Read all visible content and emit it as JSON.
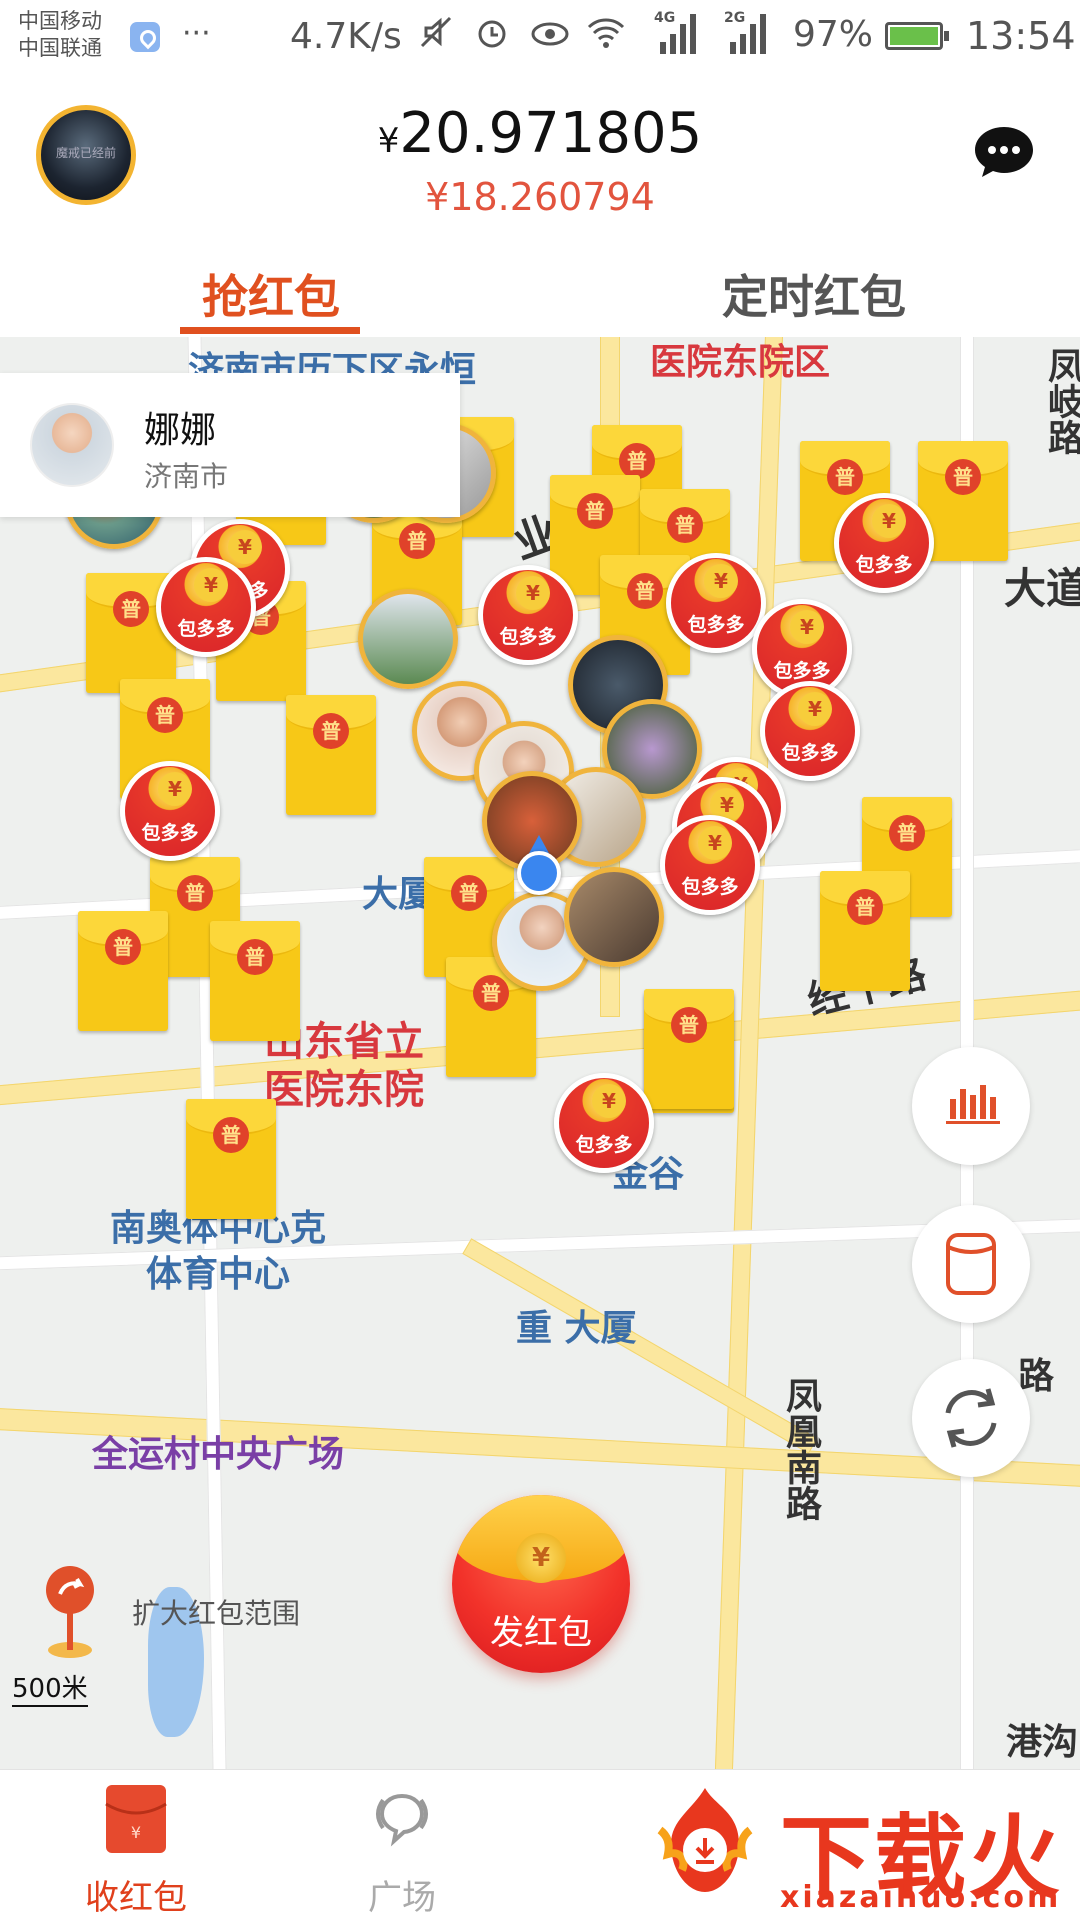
{
  "status_bar": {
    "carrier_1": "中国移动",
    "carrier_2": "中国联通",
    "more": "···",
    "net_speed": "4.7K/s",
    "net_4g": "4G",
    "net_2g": "2G",
    "battery": "97%",
    "time": "13:54"
  },
  "header": {
    "balance_currency": "¥",
    "balance_main": "20.971805",
    "balance_sub": "¥18.260794",
    "avatar_text": "魔戒已经前",
    "chat_icon": "chat-bubble-icon"
  },
  "tabs": [
    {
      "label": "抢红包",
      "active": true
    },
    {
      "label": "定时红包",
      "active": false
    }
  ],
  "user_card": {
    "name": "娜娜",
    "city": "济南市"
  },
  "map": {
    "labels": [
      {
        "text": "济南市历下区永恒",
        "style": "blue"
      },
      {
        "text": "医院东院区",
        "style": "red"
      },
      {
        "text": "业南路",
        "style": "dark"
      },
      {
        "text": "大道",
        "style": "dark"
      },
      {
        "text": "场",
        "style": "purple"
      },
      {
        "text": "大厦",
        "style": "blue"
      },
      {
        "text": "经十路",
        "style": "dark"
      },
      {
        "text": "山东省立",
        "style": "red"
      },
      {
        "text": "医院东院",
        "style": "red"
      },
      {
        "text": "金谷",
        "style": "blue"
      },
      {
        "text": "体育中心",
        "style": "blue"
      },
      {
        "text": "南奥体中心克",
        "style": "blue"
      },
      {
        "text": "重 大厦",
        "style": "blue"
      },
      {
        "text": "全运村中央广场",
        "style": "purple"
      },
      {
        "text": "凤凰南路",
        "style": "dark"
      },
      {
        "text": "凤岐路",
        "style": "dark"
      },
      {
        "text": "港沟",
        "style": "dark"
      },
      {
        "text": "路",
        "style": "dark"
      }
    ],
    "envelope_tag": "普",
    "packet_brand": "包多多",
    "coin_symbol": "¥"
  },
  "fabs": [
    {
      "icon": "bar-chart-icon"
    },
    {
      "icon": "cylinder-icon"
    },
    {
      "icon": "refresh-icon"
    }
  ],
  "send_button": {
    "label": "发红包",
    "coin": "¥"
  },
  "expand_range": {
    "label": "扩大红包范围",
    "scale": "500米"
  },
  "bottom_nav": [
    {
      "label": "收红包",
      "active": true,
      "icon": "red-envelope-icon"
    },
    {
      "label": "广场",
      "active": false,
      "icon": "speech-waves-icon"
    },
    {
      "label": "",
      "active": false,
      "icon": "obscured-icon"
    }
  ],
  "watermark": {
    "title": "下载火",
    "url": "xiazaihuo.com"
  },
  "colors": {
    "accent": "#e0501f",
    "envelope": "#f7c817",
    "packet_red": "#d9242a",
    "location": "#3a86ef"
  }
}
